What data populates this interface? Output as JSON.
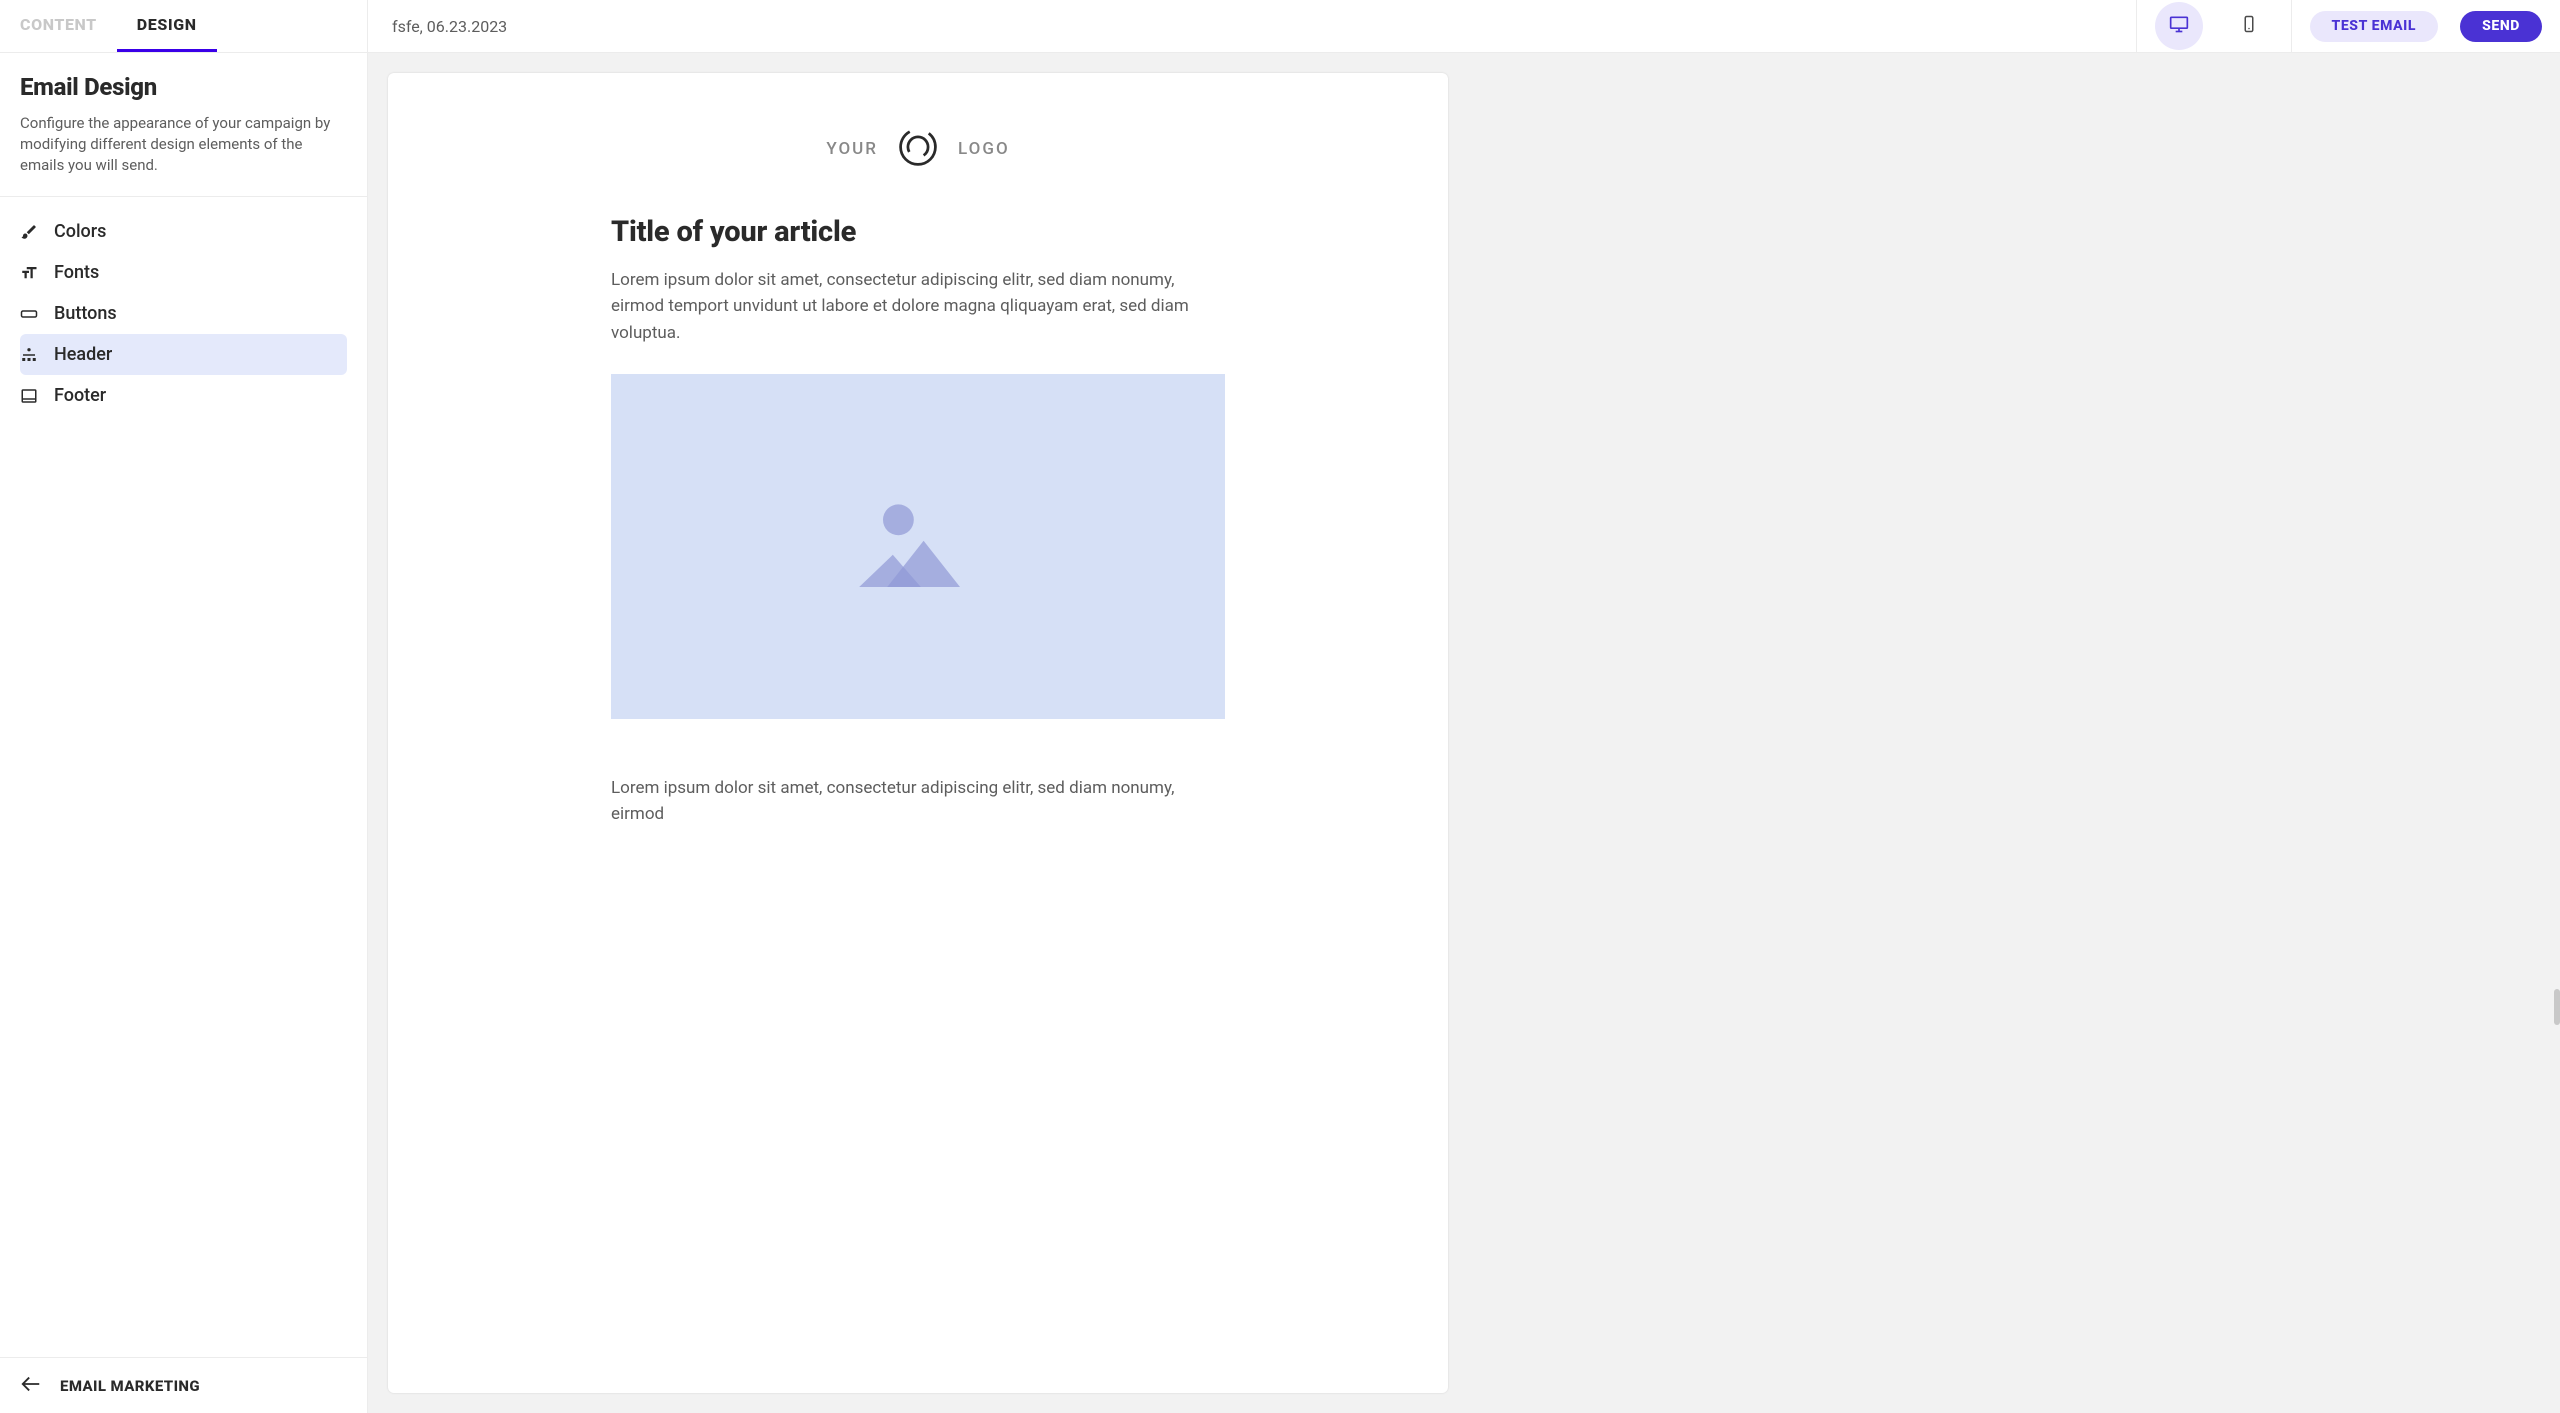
{
  "tabs": {
    "content": "CONTENT",
    "design": "DESIGN"
  },
  "section": {
    "title": "Email Design",
    "desc": "Configure the appearance of your campaign by modifying different design elements of the emails you will send."
  },
  "designItems": {
    "colors": "Colors",
    "fonts": "Fonts",
    "buttons": "Buttons",
    "header": "Header",
    "footer": "Footer"
  },
  "sidebarFooter": {
    "label": "EMAIL MARKETING"
  },
  "toolbar": {
    "title": "fsfe, 06.23.2023",
    "testEmail": "TEST EMAIL",
    "send": "SEND"
  },
  "preview": {
    "logoLeft": "YOUR",
    "logoRight": "LOGO",
    "articleTitle": "Title of your article",
    "articleBody": "Lorem ipsum dolor sit amet, consectetur adipiscing elitr, sed diam nonumy, eirmod temport unvidunt ut labore et dolore magna qliquayam erat, sed diam voluptua.",
    "articleBody2": "Lorem ipsum dolor sit amet, consectetur adipiscing elitr, sed diam nonumy, eirmod"
  }
}
